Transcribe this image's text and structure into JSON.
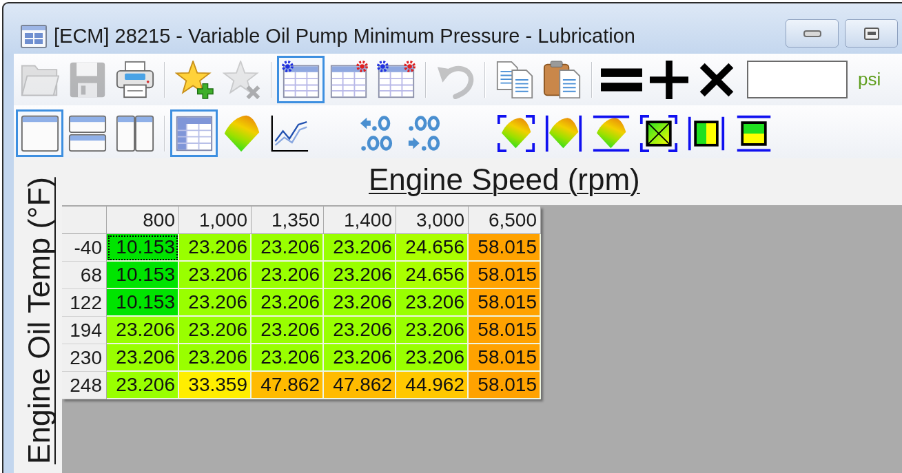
{
  "window": {
    "title": "[ECM] 28215 - Variable Oil Pump Minimum Pressure - Lubrication"
  },
  "toolbar_1": {
    "items": [
      {
        "kind": "button",
        "checked": false,
        "disabled": true
      },
      {
        "kind": "button",
        "checked": false,
        "disabled": true
      },
      {
        "kind": "button",
        "checked": false,
        "disabled": false
      },
      {
        "kind": "separator"
      },
      {
        "kind": "button",
        "checked": false,
        "disabled": false
      },
      {
        "kind": "button",
        "checked": false,
        "disabled": true
      },
      {
        "kind": "separator"
      },
      {
        "kind": "button",
        "checked": true,
        "disabled": false
      },
      {
        "kind": "button",
        "checked": false,
        "disabled": false
      },
      {
        "kind": "button",
        "checked": false,
        "disabled": false
      },
      {
        "kind": "separator"
      },
      {
        "kind": "button",
        "checked": false,
        "disabled": true
      },
      {
        "kind": "separator"
      },
      {
        "kind": "button",
        "checked": false,
        "disabled": false
      },
      {
        "kind": "button",
        "checked": false,
        "disabled": false
      },
      {
        "kind": "separator"
      },
      {
        "kind": "button",
        "checked": false,
        "disabled": false
      },
      {
        "kind": "button",
        "checked": false,
        "disabled": false
      },
      {
        "kind": "button",
        "checked": false,
        "disabled": false
      },
      {
        "kind": "field"
      },
      {
        "kind": "unit",
        "text": "psi"
      }
    ]
  },
  "toolbar_2": {
    "items": [
      {
        "kind": "button",
        "checked": true,
        "disabled": false
      },
      {
        "kind": "button",
        "checked": false,
        "disabled": false
      },
      {
        "kind": "button",
        "checked": false,
        "disabled": false
      },
      {
        "kind": "separator"
      },
      {
        "kind": "button",
        "checked": true,
        "disabled": false
      },
      {
        "kind": "button",
        "checked": false,
        "disabled": false
      },
      {
        "kind": "button",
        "checked": false,
        "disabled": false
      },
      {
        "kind": "spacer"
      },
      {
        "kind": "button",
        "checked": false,
        "disabled": false
      },
      {
        "kind": "button",
        "checked": false,
        "disabled": false
      },
      {
        "kind": "spacer"
      },
      {
        "kind": "button",
        "checked": false,
        "disabled": false
      },
      {
        "kind": "button",
        "checked": false,
        "disabled": false
      },
      {
        "kind": "button",
        "checked": false,
        "disabled": false
      },
      {
        "kind": "button",
        "checked": false,
        "disabled": false
      },
      {
        "kind": "button",
        "checked": false,
        "disabled": false
      },
      {
        "kind": "button",
        "checked": false,
        "disabled": false
      }
    ]
  },
  "x_axis_label": "Engine Speed (rpm)",
  "y_axis_label": "Engine Oil Temp (°F)",
  "table": {
    "columns": [
      "800",
      "1,000",
      "1,350",
      "1,400",
      "3,000",
      "6,500"
    ],
    "rows": [
      {
        "label": "-40",
        "cells": [
          {
            "value": "10.153",
            "color": "#00e400",
            "selected": true
          },
          {
            "value": "23.206",
            "color": "#99ff00",
            "selected": false
          },
          {
            "value": "23.206",
            "color": "#99ff00",
            "selected": false
          },
          {
            "value": "23.206",
            "color": "#99ff00",
            "selected": false
          },
          {
            "value": "24.656",
            "color": "#aaff00",
            "selected": false
          },
          {
            "value": "58.015",
            "color": "#ffa200",
            "selected": false
          }
        ]
      },
      {
        "label": "68",
        "cells": [
          {
            "value": "10.153",
            "color": "#00e400",
            "selected": false
          },
          {
            "value": "23.206",
            "color": "#99ff00",
            "selected": false
          },
          {
            "value": "23.206",
            "color": "#99ff00",
            "selected": false
          },
          {
            "value": "23.206",
            "color": "#99ff00",
            "selected": false
          },
          {
            "value": "24.656",
            "color": "#aaff00",
            "selected": false
          },
          {
            "value": "58.015",
            "color": "#ffa200",
            "selected": false
          }
        ]
      },
      {
        "label": "122",
        "cells": [
          {
            "value": "10.153",
            "color": "#00e400",
            "selected": false
          },
          {
            "value": "23.206",
            "color": "#99ff00",
            "selected": false
          },
          {
            "value": "23.206",
            "color": "#99ff00",
            "selected": false
          },
          {
            "value": "23.206",
            "color": "#99ff00",
            "selected": false
          },
          {
            "value": "23.206",
            "color": "#99ff00",
            "selected": false
          },
          {
            "value": "58.015",
            "color": "#ffa200",
            "selected": false
          }
        ]
      },
      {
        "label": "194",
        "cells": [
          {
            "value": "23.206",
            "color": "#99ff00",
            "selected": false
          },
          {
            "value": "23.206",
            "color": "#99ff00",
            "selected": false
          },
          {
            "value": "23.206",
            "color": "#99ff00",
            "selected": false
          },
          {
            "value": "23.206",
            "color": "#99ff00",
            "selected": false
          },
          {
            "value": "23.206",
            "color": "#99ff00",
            "selected": false
          },
          {
            "value": "58.015",
            "color": "#ffa200",
            "selected": false
          }
        ]
      },
      {
        "label": "230",
        "cells": [
          {
            "value": "23.206",
            "color": "#99ff00",
            "selected": false
          },
          {
            "value": "23.206",
            "color": "#99ff00",
            "selected": false
          },
          {
            "value": "23.206",
            "color": "#99ff00",
            "selected": false
          },
          {
            "value": "23.206",
            "color": "#99ff00",
            "selected": false
          },
          {
            "value": "23.206",
            "color": "#99ff00",
            "selected": false
          },
          {
            "value": "58.015",
            "color": "#ffa200",
            "selected": false
          }
        ]
      },
      {
        "label": "248",
        "cells": [
          {
            "value": "23.206",
            "color": "#99ff00",
            "selected": false
          },
          {
            "value": "33.359",
            "color": "#ffee00",
            "selected": false
          },
          {
            "value": "47.862",
            "color": "#ffbb00",
            "selected": false
          },
          {
            "value": "47.862",
            "color": "#ffbb00",
            "selected": false
          },
          {
            "value": "44.962",
            "color": "#ffc800",
            "selected": false
          },
          {
            "value": "58.015",
            "color": "#ffa200",
            "selected": false
          }
        ]
      }
    ]
  }
}
